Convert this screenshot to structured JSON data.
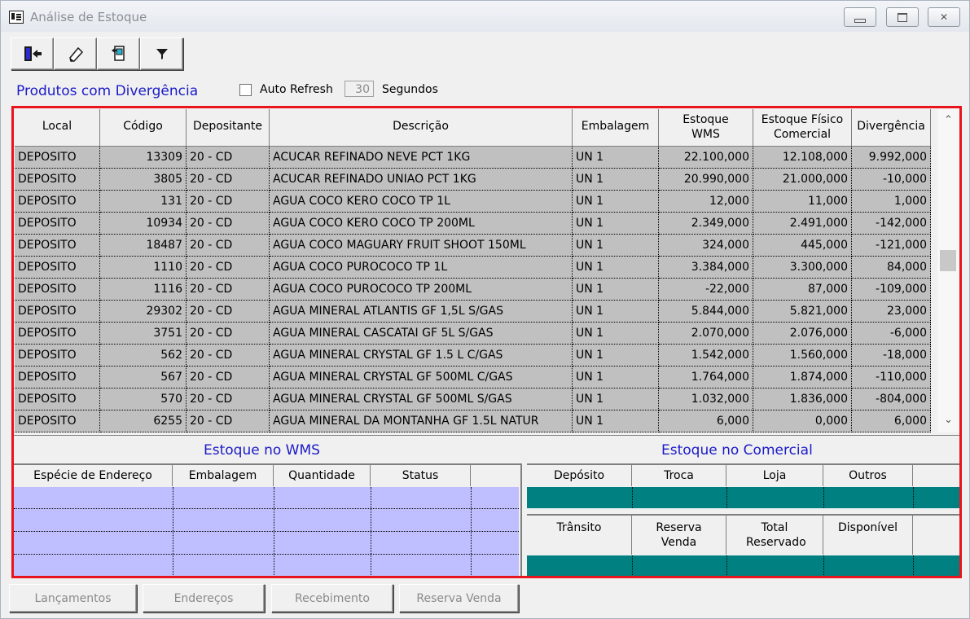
{
  "window": {
    "title": "Análise de Estoque",
    "minimize": "▭",
    "maximize": "□",
    "close": "✕"
  },
  "toolbar": {
    "buttons": [
      {
        "icon": "exit-door-icon"
      },
      {
        "icon": "eraser-icon"
      },
      {
        "icon": "export-file-icon"
      },
      {
        "icon": "filter-funnel-icon"
      }
    ]
  },
  "header_bar": {
    "section_title": "Produtos com Divergência",
    "auto_refresh_label": "Auto Refresh",
    "auto_refresh_checked": false,
    "refresh_value": "30",
    "refresh_unit": "Segundos"
  },
  "grid": {
    "columns": [
      "Local",
      "Código",
      "Depositante",
      "Descrição",
      "Embalagem",
      "Estoque WMS",
      "Estoque Físico Comercial",
      "Divergência"
    ],
    "rows": [
      [
        "DEPOSITO",
        "13309",
        "20 - CD",
        "ACUCAR REFINADO NEVE PCT 1KG",
        "UN 1",
        "22.100,000",
        "12.108,000",
        "9.992,000"
      ],
      [
        "DEPOSITO",
        "3805",
        "20 - CD",
        "ACUCAR REFINADO UNIAO PCT 1KG",
        "UN 1",
        "20.990,000",
        "21.000,000",
        "-10,000"
      ],
      [
        "DEPOSITO",
        "131",
        "20 - CD",
        "AGUA COCO KERO COCO TP 1L",
        "UN 1",
        "12,000",
        "11,000",
        "1,000"
      ],
      [
        "DEPOSITO",
        "10934",
        "20 - CD",
        "AGUA COCO KERO COCO TP 200ML",
        "UN 1",
        "2.349,000",
        "2.491,000",
        "-142,000"
      ],
      [
        "DEPOSITO",
        "18487",
        "20 - CD",
        "AGUA COCO MAGUARY FRUIT SHOOT 150ML",
        "UN 1",
        "324,000",
        "445,000",
        "-121,000"
      ],
      [
        "DEPOSITO",
        "1110",
        "20 - CD",
        "AGUA COCO PUROCOCO TP 1L",
        "UN 1",
        "3.384,000",
        "3.300,000",
        "84,000"
      ],
      [
        "DEPOSITO",
        "1116",
        "20 - CD",
        "AGUA COCO PUROCOCO TP 200ML",
        "UN 1",
        "-22,000",
        "87,000",
        "-109,000"
      ],
      [
        "DEPOSITO",
        "29302",
        "20 - CD",
        "AGUA MINERAL ATLANTIS GF 1,5L S/GAS",
        "UN 1",
        "5.844,000",
        "5.821,000",
        "23,000"
      ],
      [
        "DEPOSITO",
        "3751",
        "20 - CD",
        "AGUA MINERAL CASCATAI GF 5L S/GAS",
        "UN 1",
        "2.070,000",
        "2.076,000",
        "-6,000"
      ],
      [
        "DEPOSITO",
        "562",
        "20 - CD",
        "AGUA MINERAL CRYSTAL GF 1.5 L C/GAS",
        "UN 1",
        "1.542,000",
        "1.560,000",
        "-18,000"
      ],
      [
        "DEPOSITO",
        "567",
        "20 - CD",
        "AGUA MINERAL CRYSTAL GF 500ML C/GAS",
        "UN 1",
        "1.764,000",
        "1.874,000",
        "-110,000"
      ],
      [
        "DEPOSITO",
        "570",
        "20 - CD",
        "AGUA MINERAL CRYSTAL GF 500ML S/GAS",
        "UN 1",
        "1.032,000",
        "1.836,000",
        "-804,000"
      ],
      [
        "DEPOSITO",
        "6255",
        "20 - CD",
        "AGUA MINERAL DA MONTANHA GF 1.5L NATUR",
        "UN 1",
        "6,000",
        "0,000",
        "6,000"
      ]
    ]
  },
  "wms_panel": {
    "title": "Estoque no WMS",
    "columns": [
      "Espécie de Endereço",
      "Embalagem",
      "Quantidade",
      "Status"
    ]
  },
  "commercial_panel": {
    "title": "Estoque no Comercial",
    "columns_top": [
      "Depósito",
      "Troca",
      "Loja",
      "Outros"
    ],
    "columns_bottom": [
      "Trânsito",
      "Reserva Venda",
      "Total Reservado",
      "Disponível"
    ]
  },
  "buttons": [
    "Lançamentos",
    "Endereços",
    "Recebimento",
    "Reserva Venda"
  ],
  "colors": {
    "accent_blue": "#1a1ac8",
    "highlight": "#e8141e",
    "grid_row": "#c0c0c0",
    "wms_body": "#bfbfff",
    "teal": "#008080"
  }
}
